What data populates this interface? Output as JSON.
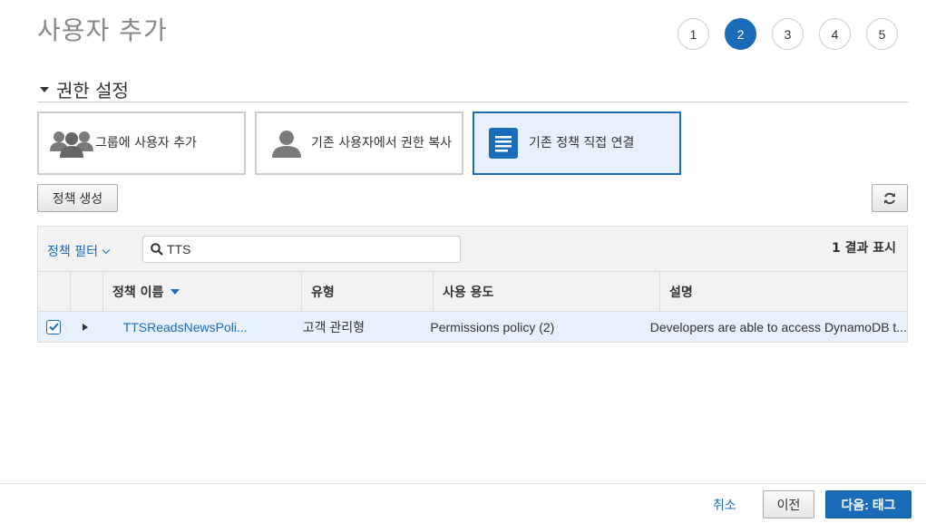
{
  "page": {
    "title": "사용자 추가"
  },
  "steps": [
    {
      "label": "1",
      "active": false
    },
    {
      "label": "2",
      "active": true
    },
    {
      "label": "3",
      "active": false
    },
    {
      "label": "4",
      "active": false
    },
    {
      "label": "5",
      "active": false
    }
  ],
  "permissions": {
    "section_title": "권한 설정",
    "options": [
      {
        "label": "그룹에 사용자 추가",
        "icon": "users-group-icon",
        "selected": false
      },
      {
        "label": "기존 사용자에서 권한 복사",
        "icon": "user-icon",
        "selected": false
      },
      {
        "label": "기존 정책 직접 연결",
        "icon": "document-icon",
        "selected": true
      }
    ]
  },
  "toolbar": {
    "create_policy_label": "정책 생성",
    "refresh_icon": "refresh-icon"
  },
  "filter": {
    "label": "정책 필터",
    "search_value": "TTS",
    "result_count": "1 결과 표시"
  },
  "table": {
    "columns": [
      "정책 이름",
      "유형",
      "사용 용도",
      "설명"
    ],
    "rows": [
      {
        "checked": true,
        "name": "TTSReadsNewsPoli...",
        "type": "고객 관리형",
        "usage": "Permissions policy (2)",
        "description": "Developers are able to access DynamoDB t..."
      }
    ]
  },
  "footer": {
    "cancel_label": "취소",
    "prev_label": "이전",
    "next_label": "다음: 태그"
  },
  "colors": {
    "accent": "#1a6cb8",
    "selected_bg": "#e8f1fb",
    "header_bg": "#f2f2f2"
  }
}
